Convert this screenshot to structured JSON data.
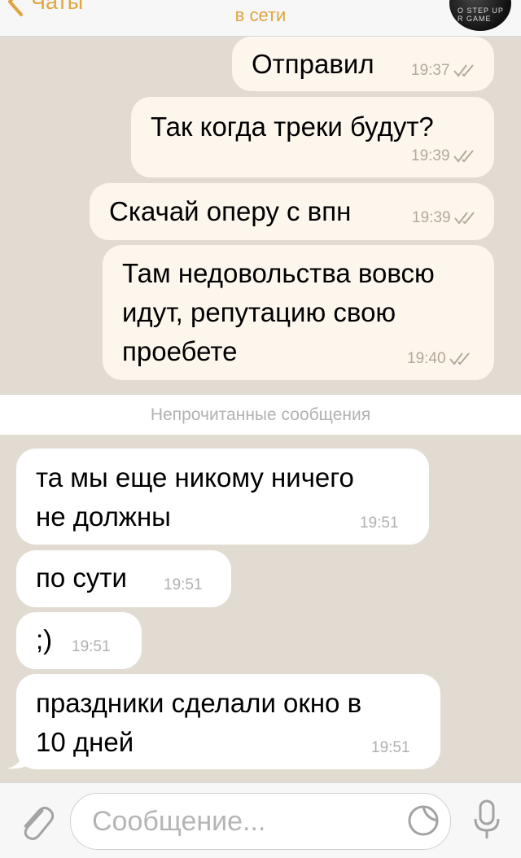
{
  "header": {
    "back_label": "Чаты",
    "status": "в сети",
    "avatar_text": "O STEP UP R GAME"
  },
  "messages": [
    {
      "direction": "out",
      "lines": [
        "Отправил"
      ],
      "time": "19:37"
    },
    {
      "direction": "out",
      "lines": [
        "Так когда треки будут?"
      ],
      "time": "19:39"
    },
    {
      "direction": "out",
      "lines": [
        "Скачай оперу с впн"
      ],
      "time": "19:39"
    },
    {
      "direction": "out",
      "lines": [
        "Там недовольства вовсю",
        "идут, репутацию  свою",
        "проебете"
      ],
      "time": "19:40"
    },
    {
      "direction": "in",
      "lines": [
        "та мы еще никому ничего",
        "не должны"
      ],
      "time": "19:51"
    },
    {
      "direction": "in",
      "lines": [
        "по сути"
      ],
      "time": "19:51"
    },
    {
      "direction": "in",
      "lines": [
        ";)"
      ],
      "time": "19:51"
    },
    {
      "direction": "in",
      "lines": [
        "праздники сделали окно в",
        "10 дней"
      ],
      "time": "19:51"
    }
  ],
  "unread_separator": "Непрочитанные сообщения",
  "input": {
    "placeholder": "Сообщение..."
  },
  "icons": {
    "back": "chevron-left-icon",
    "attach": "paperclip-icon",
    "sticker": "sticker-icon",
    "mic": "microphone-icon",
    "read": "double-check-icon"
  },
  "colors": {
    "accent": "#e0a540",
    "background": "#e2dbd1",
    "outgoing_bubble": "#fdf6ed",
    "incoming_bubble": "#ffffff"
  }
}
